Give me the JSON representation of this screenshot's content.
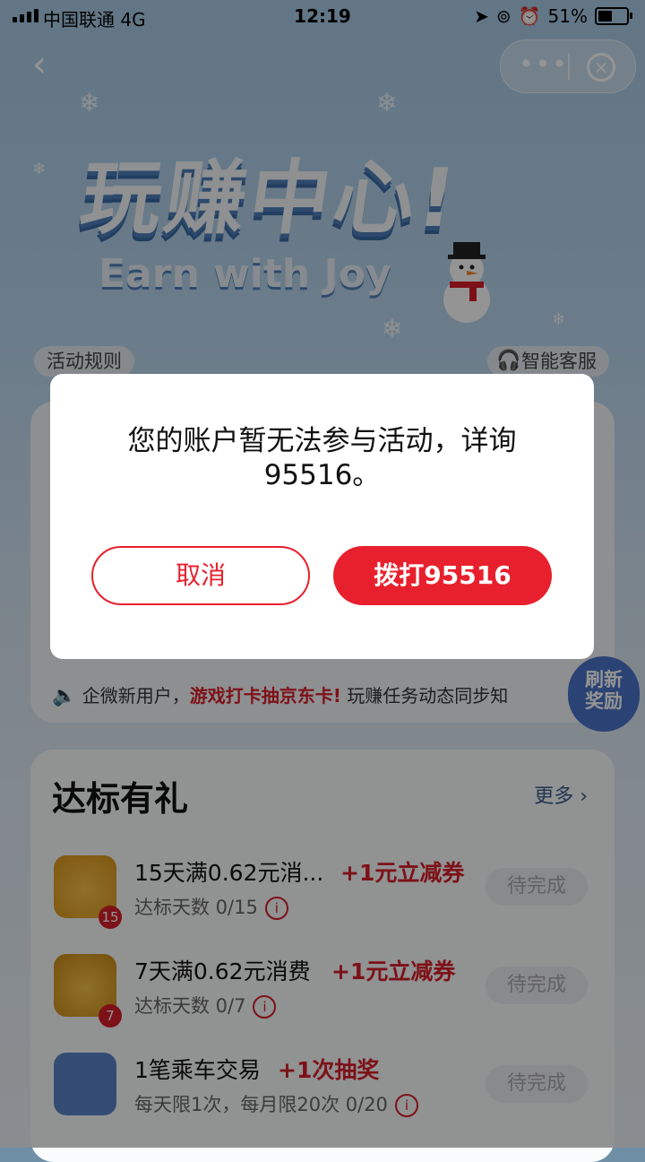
{
  "status_bar": {
    "carrier": "中国联通  4G",
    "time": "12:19",
    "battery": "51%"
  },
  "banner": {
    "title": "玩赚中心!",
    "subtitle": "Earn with Joy"
  },
  "links": {
    "rules": "活动规则",
    "service": "智能客服"
  },
  "notice": {
    "prefix": "企微新用户，",
    "highlight": "游戏打卡抽京东卡!",
    "suffix": " 玩赚任务动态同步知"
  },
  "refresh": {
    "label_line1": "刷新",
    "label_line2": "奖励"
  },
  "tasks_section": {
    "title": "达标有礼",
    "more": "更多 ›",
    "items": [
      {
        "name": "15天满0.62元消...",
        "reward": "+1元立减券",
        "progress": "达标天数 0/15",
        "status": "待完成",
        "badge": "15"
      },
      {
        "name": "7天满0.62元消费",
        "reward": "+1元立减券",
        "progress": "达标天数 0/7",
        "status": "待完成",
        "badge": "7"
      },
      {
        "name": "1笔乘车交易",
        "reward": "+1次抽奖",
        "progress": "每天限1次，每月限20次 0/20",
        "status": "待完成"
      }
    ]
  },
  "dialog": {
    "message": "您的账户暂无法参与活动，详询95516。",
    "cancel": "取消",
    "call": "拨打95516"
  },
  "colors": {
    "accent": "#e8202d",
    "link": "#3a5a8c"
  }
}
